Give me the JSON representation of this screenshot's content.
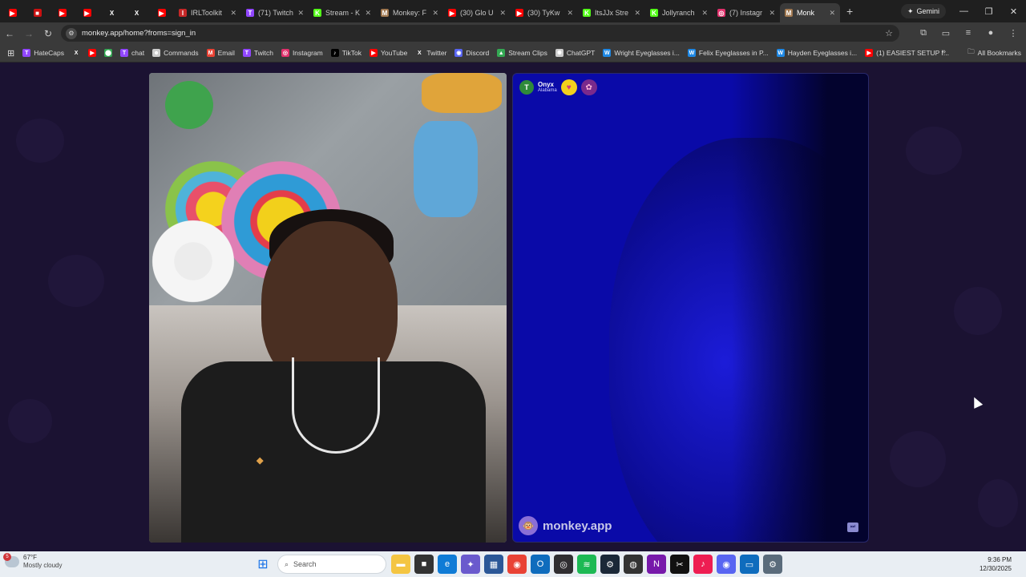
{
  "browser": {
    "tabs": [
      {
        "label": "",
        "icon": "youtube-icon",
        "color": "#ff0000"
      },
      {
        "label": "",
        "icon": "app-icon",
        "color": "#cc1111"
      },
      {
        "label": "",
        "icon": "youtube-icon",
        "color": "#ff0000"
      },
      {
        "label": "",
        "icon": "youtube-icon",
        "color": "#ff0000"
      },
      {
        "label": "",
        "icon": "x-icon",
        "color": "#ffffff"
      },
      {
        "label": "",
        "icon": "x-icon",
        "color": "#ffffff"
      },
      {
        "label": "",
        "icon": "youtube-icon",
        "color": "#ff0000"
      },
      {
        "label": "IRLToolkit",
        "icon": "irltoolkit-icon",
        "color": "#c62828"
      },
      {
        "label": "(71) Twitch",
        "icon": "twitch-icon",
        "color": "#9146ff"
      },
      {
        "label": "Stream - K",
        "icon": "kick-icon",
        "color": "#53fc18"
      },
      {
        "label": "Monkey: F",
        "icon": "monkey-icon",
        "color": "#a07850"
      },
      {
        "label": "(30) Glo U",
        "icon": "youtube-icon",
        "color": "#ff0000"
      },
      {
        "label": "(30) TyKw",
        "icon": "youtube-icon",
        "color": "#ff0000"
      },
      {
        "label": "ItsJJx Stre",
        "icon": "kick-icon",
        "color": "#53fc18"
      },
      {
        "label": "Jollyranch",
        "icon": "kick-icon",
        "color": "#53fc18"
      },
      {
        "label": "(7) Instagr",
        "icon": "instagram-icon",
        "color": "#e1306c"
      },
      {
        "label": "Monk",
        "icon": "monkey-icon",
        "color": "#a07850",
        "active": true
      }
    ],
    "gemini_label": "Gemini",
    "url": "monkey.app/home?froms=sign_in",
    "bookmarks": [
      {
        "label": "HateCaps",
        "icon": "twitch-icon",
        "color": "#9146ff"
      },
      {
        "label": "",
        "icon": "x-icon",
        "color": "#ffffff"
      },
      {
        "label": "",
        "icon": "youtube-icon",
        "color": "#ff0000"
      },
      {
        "label": "",
        "icon": "maps-icon",
        "color": "#34a853"
      },
      {
        "label": "chat",
        "icon": "twitch-icon",
        "color": "#9146ff"
      },
      {
        "label": "Commands",
        "icon": "bot-icon",
        "color": "#cccccc"
      },
      {
        "label": "Email",
        "icon": "gmail-icon",
        "color": "#ea4335"
      },
      {
        "label": "Twitch",
        "icon": "twitch-icon",
        "color": "#9146ff"
      },
      {
        "label": "Instagram",
        "icon": "instagram-icon",
        "color": "#e1306c"
      },
      {
        "label": "TikTok",
        "icon": "tiktok-icon",
        "color": "#000000"
      },
      {
        "label": "YouTube",
        "icon": "youtube-icon",
        "color": "#ff0000"
      },
      {
        "label": "Twitter",
        "icon": "x-icon",
        "color": "#ffffff"
      },
      {
        "label": "Discord",
        "icon": "discord-icon",
        "color": "#5865f2"
      },
      {
        "label": "Stream Clips",
        "icon": "drive-icon",
        "color": "#34a853"
      },
      {
        "label": "ChatGPT",
        "icon": "chatgpt-icon",
        "color": "#cccccc"
      },
      {
        "label": "Wright Eyeglasses i...",
        "icon": "wp-icon",
        "color": "#1e88e5"
      },
      {
        "label": "Felix Eyeglasses in P...",
        "icon": "wp-icon",
        "color": "#1e88e5"
      },
      {
        "label": "Hayden Eyeglasses i...",
        "icon": "wp-icon",
        "color": "#1e88e5"
      },
      {
        "label": "(1) EASIEST SETUP f...",
        "icon": "youtube-icon",
        "color": "#ff0000"
      }
    ],
    "all_bookmarks_label": "All Bookmarks"
  },
  "app": {
    "remote_user": {
      "initial": "T",
      "name": "Onyx",
      "location": "Alabama"
    },
    "brand": "monkey.app",
    "accent_color": "#8b6fd6"
  },
  "taskbar": {
    "weather": {
      "temp": "67°F",
      "desc": "Mostly cloudy",
      "badge": "5"
    },
    "search_placeholder": "Search",
    "time": "9:36 PM",
    "date": "12/30/2025",
    "apps": [
      {
        "icon": "file-explorer-icon",
        "color": "#f4c542"
      },
      {
        "icon": "app-icon",
        "color": "#333333"
      },
      {
        "icon": "edge-icon",
        "color": "#0f7bd6"
      },
      {
        "icon": "copilot-icon",
        "color": "#6a5acd"
      },
      {
        "icon": "store-icon",
        "color": "#2b5797"
      },
      {
        "icon": "chrome-icon",
        "color": "#e94235"
      },
      {
        "icon": "outlook-icon",
        "color": "#0f6cbd"
      },
      {
        "icon": "obs-icon",
        "color": "#302e31"
      },
      {
        "icon": "spotify-icon",
        "color": "#1db954"
      },
      {
        "icon": "steam-icon",
        "color": "#1b2838"
      },
      {
        "icon": "controller-icon",
        "color": "#333333"
      },
      {
        "icon": "onenote-icon",
        "color": "#7719aa"
      },
      {
        "icon": "capcut-icon",
        "color": "#111111"
      },
      {
        "icon": "tiktok-icon",
        "color": "#ee1d52"
      },
      {
        "icon": "discord-icon",
        "color": "#5865f2"
      },
      {
        "icon": "remote-desktop-icon",
        "color": "#0f6cbd"
      },
      {
        "icon": "settings-icon",
        "color": "#5a6b7b"
      }
    ]
  }
}
